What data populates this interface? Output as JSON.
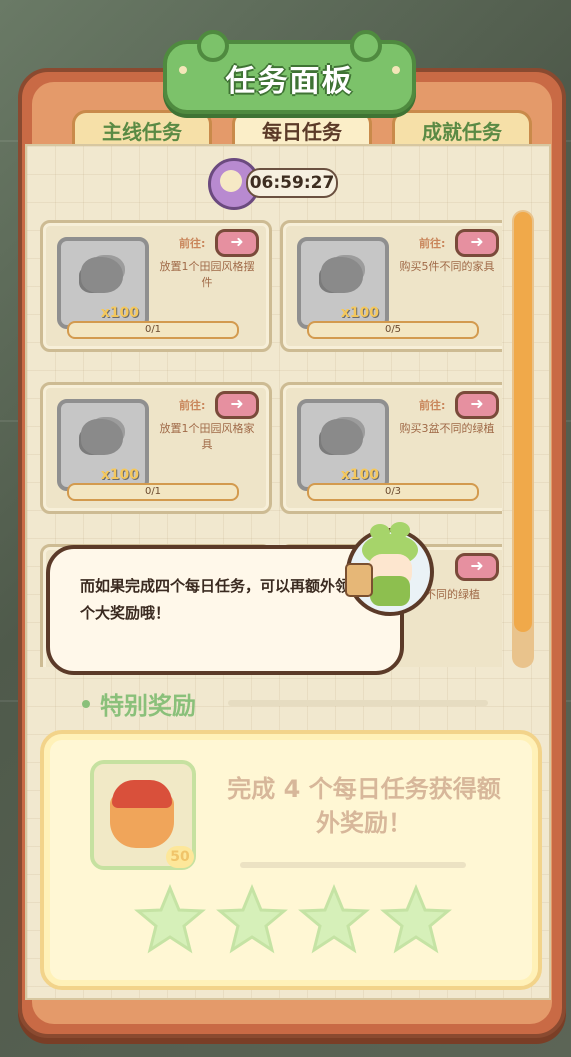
{
  "panel": {
    "title": "任务面板"
  },
  "tabs": [
    {
      "label": "主线任务",
      "active": false
    },
    {
      "label": "每日任务",
      "active": true
    },
    {
      "label": "成就任务",
      "active": false
    }
  ],
  "timer": {
    "value": "06:59:27"
  },
  "tasks": [
    {
      "goto_label": "前往:",
      "description": "放置1个田园风格摆件",
      "reward_qty": "x100",
      "progress": "0/1"
    },
    {
      "goto_label": "前往:",
      "description": "购买5件不同的家具",
      "reward_qty": "x100",
      "progress": "0/5"
    },
    {
      "goto_label": "前往:",
      "description": "放置1个田园风格家具",
      "reward_qty": "x100",
      "progress": "0/1"
    },
    {
      "goto_label": "前往:",
      "description": "购买3盆不同的绿植",
      "reward_qty": "x100",
      "progress": "0/3"
    },
    {
      "goto_label": "",
      "description": "盆不同的绿植",
      "reward_qty": "",
      "progress": ""
    }
  ],
  "dialog": {
    "text": "而如果完成四个每日任务，可以再额外领取一个大奖励哦！"
  },
  "special": {
    "title": "特别奖励",
    "reward_qty": "50",
    "text": "完成 4 个每日任务获得额外奖励！",
    "stars_total": 4,
    "stars_filled": 0
  },
  "colors": {
    "accent_green": "#7cc26a",
    "frame_orange": "#c96a45",
    "paper": "#f1e8cf"
  }
}
